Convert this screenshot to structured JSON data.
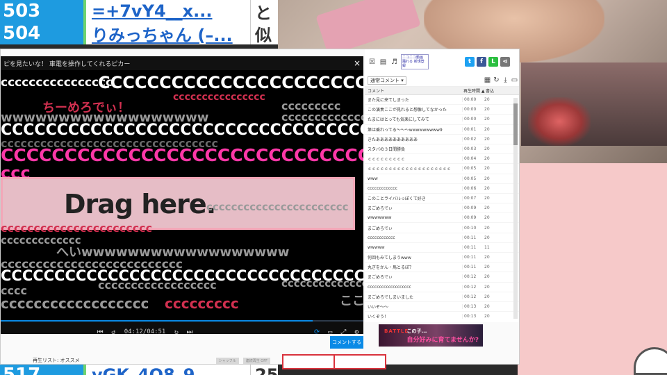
{
  "sheet": {
    "rows": [
      {
        "num": "503",
        "name": "=+7vY4__x...",
        "extra": "と"
      },
      {
        "num": "504",
        "name": "りみっちゃん (–...",
        "extra": "似"
      },
      {
        "num": "517",
        "name": "vGK_4O8_9...",
        "extra": "25"
      }
    ]
  },
  "player": {
    "title": "ピを見たいな！ 車電を操作してくれるピカー",
    "close": "×",
    "drag_label": "Drag here.",
    "time": "04:12/04:51",
    "progress": 0.86,
    "comment_button": "コメントする",
    "comments": [
      "cccccccccccccccc",
      "CCCCCCCCCCCCCCCCCCCCCCCCC",
      "cccccccccccccccc",
      "ccccccccc",
      "ちーめろでぃ！",
      "wwwwwwwwwwwwwwwwww",
      "cccccccccccccc",
      "CCCCCCCCCCCCCCCCCCCCCCCCCCCCCCCCCCCCCCC",
      "ccccccccccccccccccccccccccccccccc",
      "CCCCCCCCCCCCCCCCCCCCCCCCCCCCCCCCCCCC",
      "ccc",
      "ccccccccccccccccccccccc",
      "ccccccccccccccccccccccc",
      "ccccccccccccc",
      "へいwwwwwwwwwwwwwwwwww",
      "cccccccccccccccccccccccccc",
      "CCCCCCCCCCCCCCCCCCCCCCCCCCCCCCCCCCC",
      "cccccccccccccccccc",
      "cccc",
      "ccccccccccccccccccccc",
      "cccccccccccccccccc",
      "ccccccccc",
      "ここ"
    ]
  },
  "panel": {
    "badge": "ニコニコ動画 踊れる 新規登録",
    "sort": "通常コメント ▾",
    "col_comment": "コメント",
    "col_time": "再生時間 ▲",
    "col_date": "書込",
    "rows": [
      {
        "text": "また見に来てしまった",
        "time": "00:00",
        "date": "20"
      },
      {
        "text": "この演奏ここが見れると想像してなかった",
        "time": "00:00",
        "date": "20"
      },
      {
        "text": "たまにはとっても気楽にしてみて",
        "time": "00:00",
        "date": "20"
      },
      {
        "text": "第は乗れってる～～～wwwwwwwww9",
        "time": "00:01",
        "date": "20"
      },
      {
        "text": "きたああああああああああ",
        "time": "00:02",
        "date": "20"
      },
      {
        "text": "スタバの３日間勝負",
        "time": "00:03",
        "date": "20"
      },
      {
        "text": "ｃｃｃｃｃｃｃｃｃ",
        "time": "00:04",
        "date": "20"
      },
      {
        "text": "ｃｃｃｃｃｃｃｃｃｃｃｃｃｃｃｃｃｃｃｃ",
        "time": "00:05",
        "date": "20"
      },
      {
        "text": "www",
        "time": "00:05",
        "date": "20"
      },
      {
        "text": "ccccccccccccc",
        "time": "00:06",
        "date": "20"
      },
      {
        "text": "このことライバルっぽくて好き",
        "time": "00:07",
        "date": "20"
      },
      {
        "text": "まごめろでぃ",
        "time": "00:09",
        "date": "20"
      },
      {
        "text": "wwwwwww",
        "time": "00:09",
        "date": "20"
      },
      {
        "text": "まごめろでぃ",
        "time": "00:10",
        "date": "20"
      },
      {
        "text": "cccccccccccc",
        "time": "00:11",
        "date": "20"
      },
      {
        "text": "wwwww",
        "time": "00:11",
        "date": "11"
      },
      {
        "text": "何回もみてしまうwww",
        "time": "00:11",
        "date": "20"
      },
      {
        "text": "丸ぎをかん・馬とるぼ？",
        "time": "00:11",
        "date": "20"
      },
      {
        "text": "まごめろでぃ",
        "time": "00:12",
        "date": "20"
      },
      {
        "text": "ccccccccccccccccccc",
        "time": "00:12",
        "date": "20"
      },
      {
        "text": "まごめろでしまいました",
        "time": "00:12",
        "date": "20"
      },
      {
        "text": "いいぞ～～",
        "time": "00:13",
        "date": "20"
      },
      {
        "text": "いくぞう！",
        "time": "00:13",
        "date": "20"
      }
    ]
  },
  "ad": {
    "logo": "BATTLE",
    "line1": "この子...",
    "line2": "自分好みに育てませんか?"
  },
  "playlist": {
    "label": "再生リスト: オススメ",
    "shuffle": "シャッフル",
    "loop": "連続再生 OFF"
  },
  "colors": {
    "accent": "#0a8ae6",
    "sheet_blue": "#1e9be0",
    "comment_pink": "#ff38a8",
    "panel_bg": "#ffffff",
    "pink_bg": "#f6c9c9"
  }
}
